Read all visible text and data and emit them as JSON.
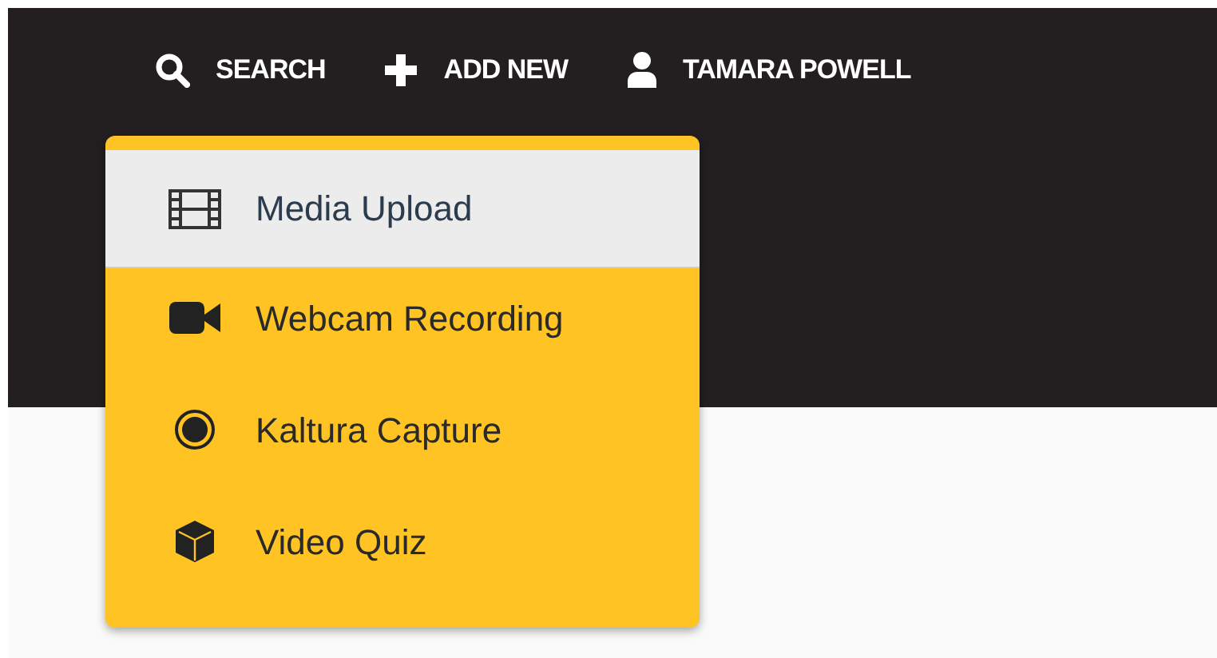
{
  "navbar": {
    "items": [
      {
        "kind": "search",
        "label": "SEARCH"
      },
      {
        "kind": "add",
        "label": "ADD NEW"
      },
      {
        "kind": "user",
        "label": "TAMARA POWELL"
      }
    ]
  },
  "dropdown": {
    "items": [
      {
        "kind": "film",
        "label": "Media Upload",
        "selected": true
      },
      {
        "kind": "camera",
        "label": "Webcam Recording",
        "selected": false
      },
      {
        "kind": "record",
        "label": "Kaltura Capture",
        "selected": false
      },
      {
        "kind": "cube",
        "label": "Video Quiz",
        "selected": false
      }
    ]
  }
}
